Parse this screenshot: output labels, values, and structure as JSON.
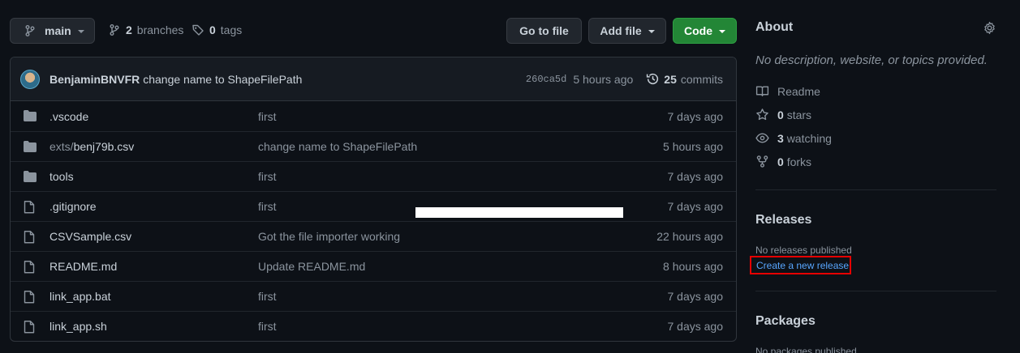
{
  "toolbar": {
    "branch_name": "main",
    "branches_count": "2",
    "branches_label": "branches",
    "tags_count": "0",
    "tags_label": "tags",
    "go_to_file_label": "Go to file",
    "add_file_label": "Add file",
    "code_label": "Code"
  },
  "commit": {
    "author": "BenjaminBNVFR",
    "message": "change name to ShapeFilePath",
    "sha": "260ca5d",
    "time": "5 hours ago",
    "commits_count": "25",
    "commits_label": "commits"
  },
  "files": [
    {
      "type": "folder",
      "name": ".vscode",
      "message": "first",
      "age": "7 days ago"
    },
    {
      "type": "folder",
      "dir": "exts/",
      "name": "benj79b.csv",
      "message": "change name to ShapeFilePath",
      "age": "5 hours ago"
    },
    {
      "type": "folder",
      "name": "tools",
      "message": "first",
      "age": "7 days ago"
    },
    {
      "type": "file",
      "name": ".gitignore",
      "message": "first",
      "age": "7 days ago"
    },
    {
      "type": "file",
      "name": "CSVSample.csv",
      "message": "Got the file importer working",
      "age": "22 hours ago"
    },
    {
      "type": "file",
      "name": "README.md",
      "message": "Update README.md",
      "age": "8 hours ago"
    },
    {
      "type": "file",
      "name": "link_app.bat",
      "message": "first",
      "age": "7 days ago"
    },
    {
      "type": "file",
      "name": "link_app.sh",
      "message": "first",
      "age": "7 days ago"
    }
  ],
  "about": {
    "title": "About",
    "description": "No description, website, or topics provided.",
    "readme_label": "Readme",
    "stars_count": "0",
    "stars_label": "stars",
    "watching_count": "3",
    "watching_label": "watching",
    "forks_count": "0",
    "forks_label": "forks"
  },
  "releases": {
    "title": "Releases",
    "empty_text": "No releases published",
    "create_link": "Create a new release"
  },
  "packages": {
    "title": "Packages",
    "empty_text": "No packages published"
  },
  "colors": {
    "background": "#0d1117",
    "code_button": "#238636",
    "link": "#58a6ff",
    "highlight_box": "#e60000"
  }
}
